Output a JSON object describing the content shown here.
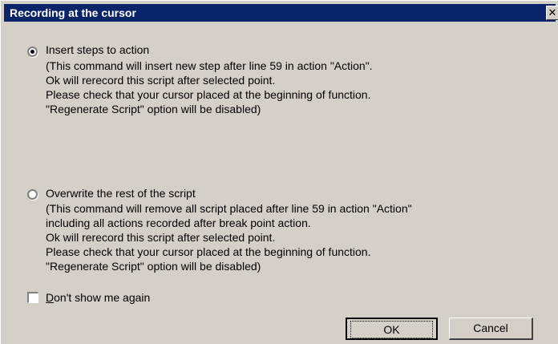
{
  "window": {
    "title": "Recording at the cursor",
    "close_glyph": "✕"
  },
  "options": [
    {
      "label": "Insert steps to action",
      "selected": true,
      "description": [
        "(This command will insert new step after line 59 in action \"Action\".",
        "Ok will rerecord this script after selected point.",
        "Please check that your cursor placed at the beginning of function.",
        "\"Regenerate Script\" option will be disabled)"
      ]
    },
    {
      "label": "Overwrite the rest of the script",
      "selected": false,
      "description": [
        "(This command will remove all script placed after line 59 in action \"Action\"",
        "including all actions recorded after break point action.",
        "Ok will rerecord this script after selected point.",
        "Please check that your cursor placed at the beginning of function.",
        "\"Regenerate Script\" option will be disabled)"
      ]
    }
  ],
  "dont_show": {
    "label": "Don't show me again",
    "checked": false
  },
  "buttons": {
    "ok_label": "OK",
    "cancel_label": "Cancel"
  },
  "colors": {
    "titlebar": "#0a246a",
    "dialog_face": "#d4d0c8"
  }
}
